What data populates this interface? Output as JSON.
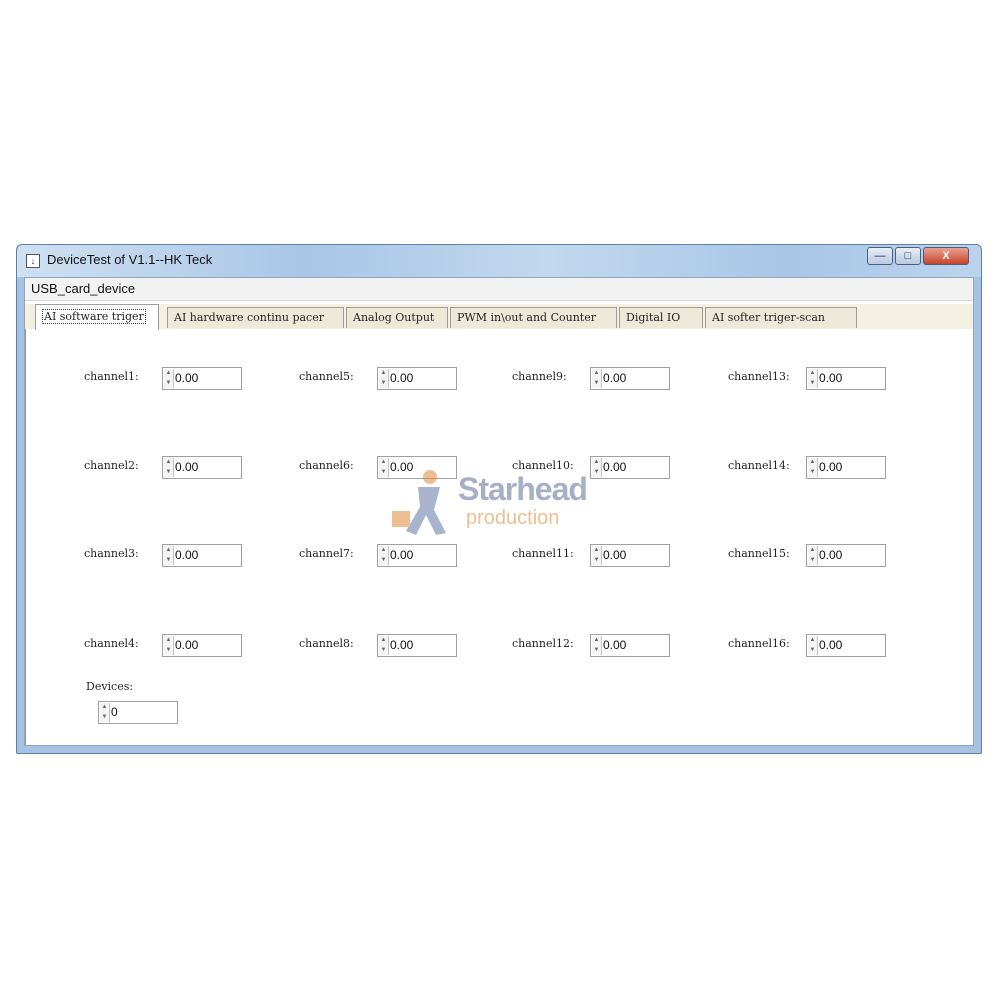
{
  "window": {
    "title": "DeviceTest of V1.1--HK Teck",
    "min_glyph": "—",
    "max_glyph": "□",
    "close_glyph": "X"
  },
  "menu": {
    "item": "USB_card_device"
  },
  "tabs": [
    "AI software triger",
    "AI hardware continu pacer",
    "Analog Output",
    "PWM in\\out and Counter",
    "Digital IO",
    "AI softer triger-scan"
  ],
  "channels": [
    {
      "label": "channel1:",
      "value": "0.00"
    },
    {
      "label": "channel2:",
      "value": "0.00"
    },
    {
      "label": "channel3:",
      "value": "0.00"
    },
    {
      "label": "channel4:",
      "value": "0.00"
    },
    {
      "label": "channel5:",
      "value": "0.00"
    },
    {
      "label": "channel6:",
      "value": "0.00"
    },
    {
      "label": "channel7:",
      "value": "0.00"
    },
    {
      "label": "channel8:",
      "value": "0.00"
    },
    {
      "label": "channel9:",
      "value": "0.00"
    },
    {
      "label": "channel10:",
      "value": "0.00"
    },
    {
      "label": "channel11:",
      "value": "0.00"
    },
    {
      "label": "channel12:",
      "value": "0.00"
    },
    {
      "label": "channel13:",
      "value": "0.00"
    },
    {
      "label": "channel14:",
      "value": "0.00"
    },
    {
      "label": "channel15:",
      "value": "0.00"
    },
    {
      "label": "channel16:",
      "value": "0.00"
    }
  ],
  "devices": {
    "label": "Devices:",
    "value": "0"
  },
  "watermark": {
    "line1": "Starhead",
    "line2": "production"
  },
  "icons": {
    "app": "app-window-icon",
    "spin": "spin-up-down-icon"
  },
  "colors": {
    "title_bar": "#a9c6e6",
    "close_button": "#c7432a",
    "tab_background": "#ece9d8"
  }
}
